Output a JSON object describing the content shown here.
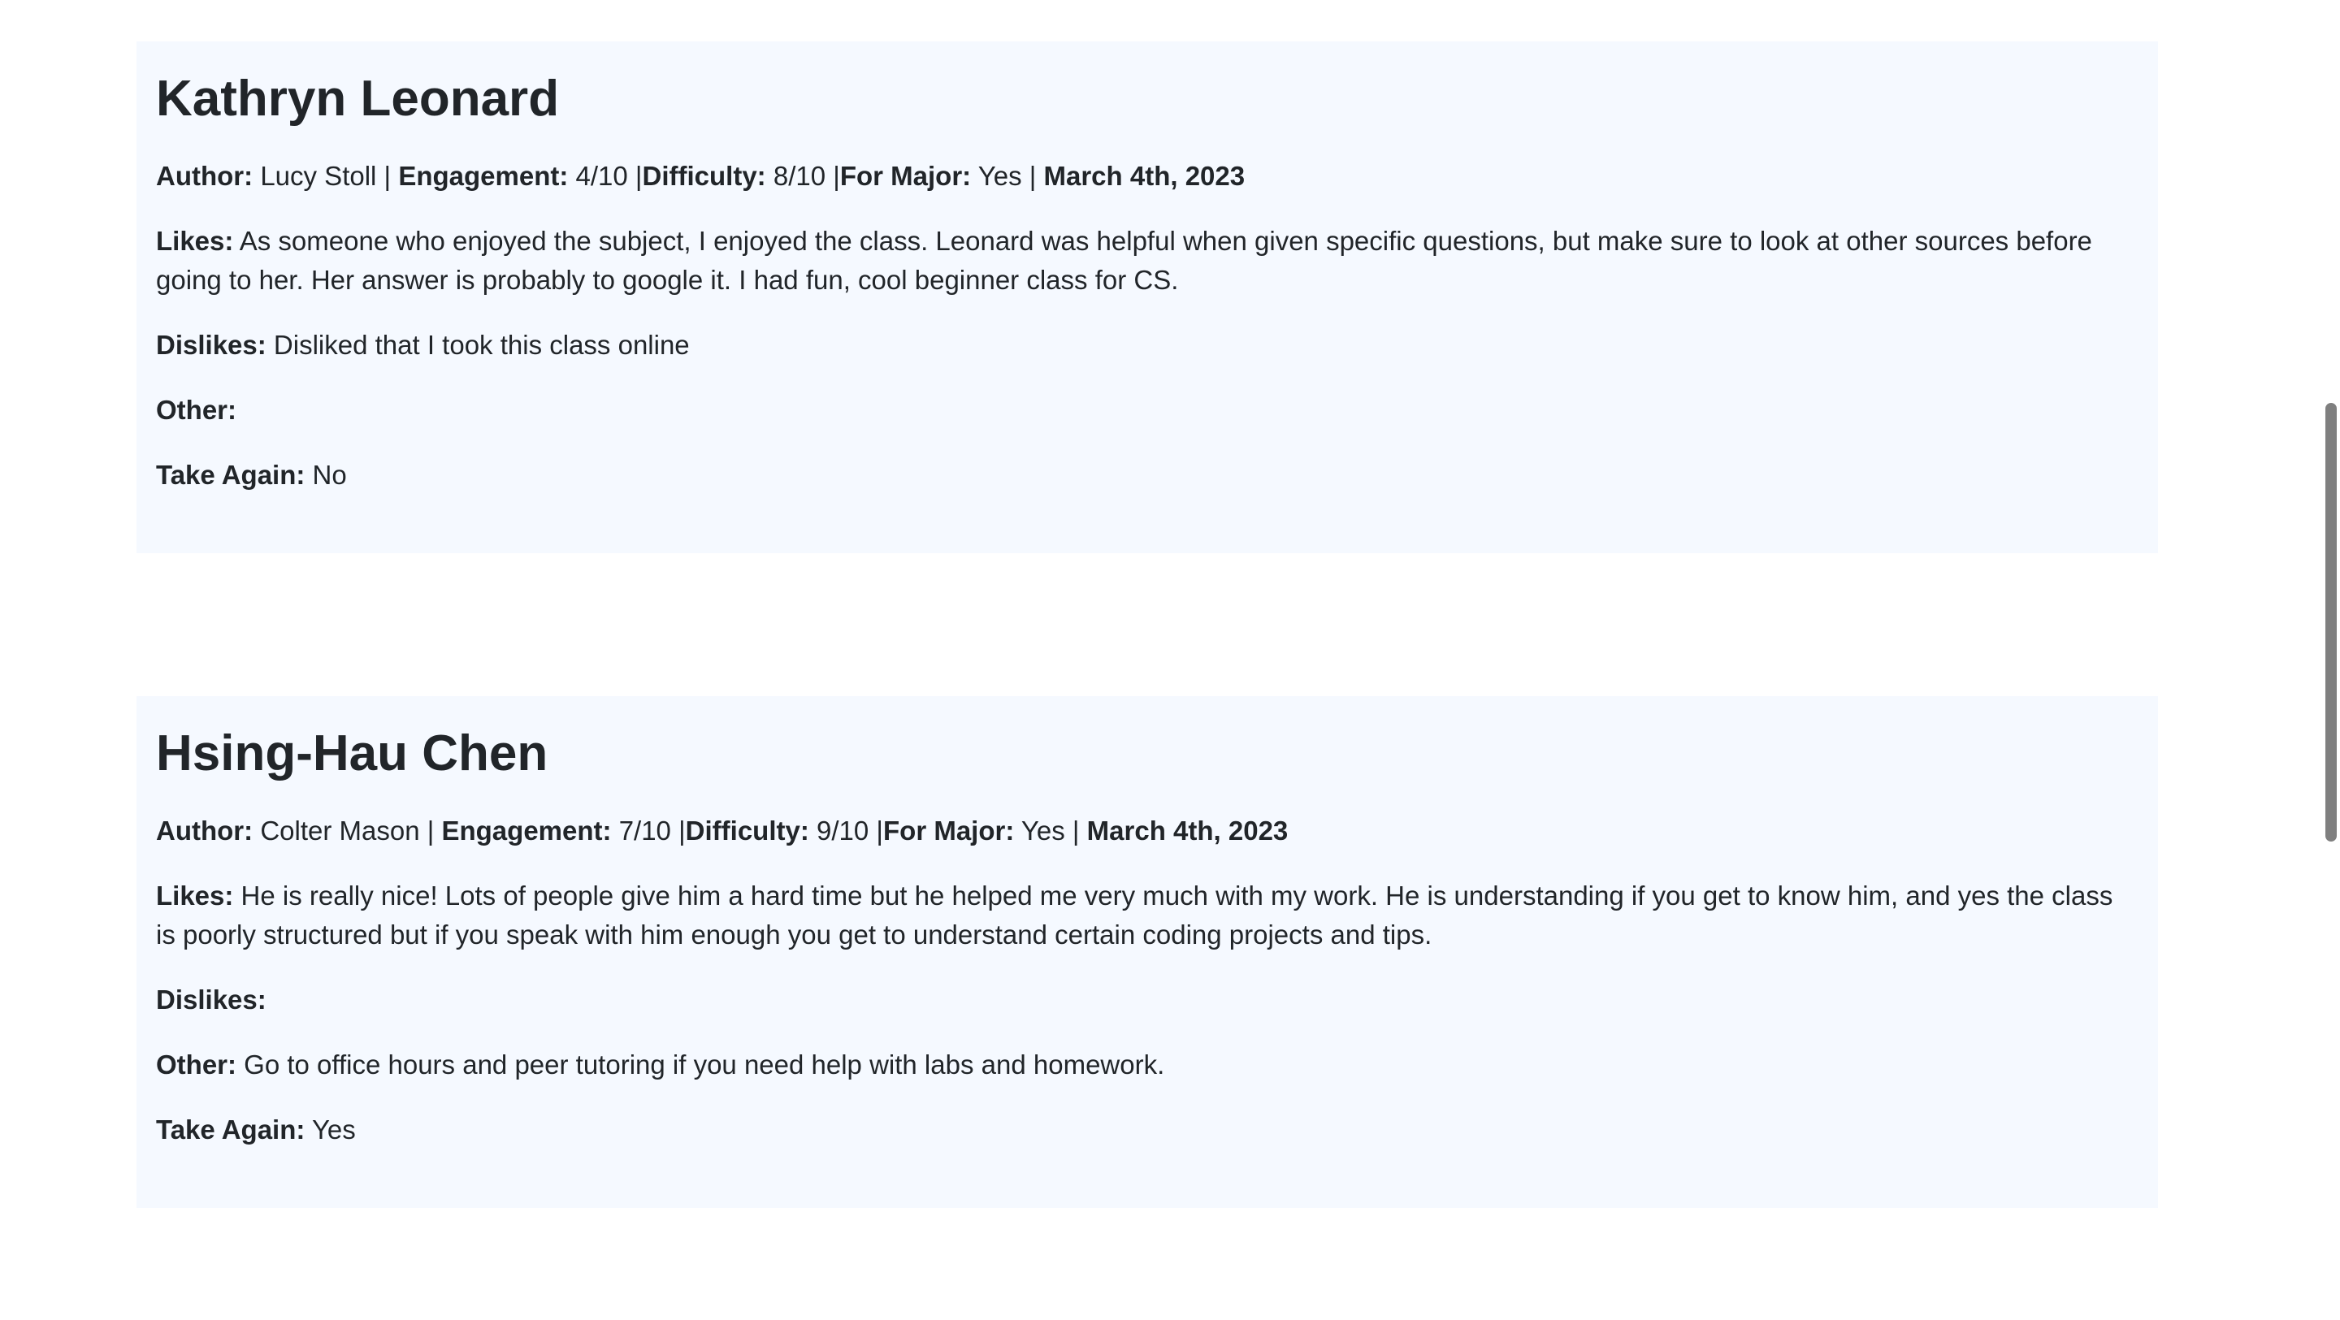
{
  "reviews": [
    {
      "professor": "Kathryn Leonard",
      "author_label": "Author:",
      "author": "Lucy Stoll",
      "engagement_label": "Engagement:",
      "engagement": "4/10",
      "difficulty_label": "Difficulty:",
      "difficulty": "8/10",
      "major_label": "For Major:",
      "major": "Yes",
      "date": "March 4th, 2023",
      "likes_label": "Likes:",
      "likes": "As someone who enjoyed the subject, I enjoyed the class. Leonard was helpful when given specific questions, but make sure to look at other sources before going to her. Her answer is probably to google it. I had fun, cool beginner class for CS.",
      "dislikes_label": "Dislikes:",
      "dislikes": "Disliked that I took this class online",
      "other_label": "Other:",
      "other": "",
      "take_again_label": "Take Again:",
      "take_again": "No"
    },
    {
      "professor": "Hsing-Hau Chen",
      "author_label": "Author:",
      "author": "Colter Mason",
      "engagement_label": "Engagement:",
      "engagement": "7/10",
      "difficulty_label": "Difficulty:",
      "difficulty": "9/10",
      "major_label": "For Major:",
      "major": "Yes",
      "date": "March 4th, 2023",
      "likes_label": "Likes:",
      "likes": "He is really nice! Lots of people give him a hard time but he helped me very much with my work. He is understanding if you get to know him, and yes the class is poorly structured but if you speak with him enough you get to understand certain coding projects and tips.",
      "dislikes_label": "Dislikes:",
      "dislikes": "",
      "other_label": "Other:",
      "other": "Go to office hours and peer tutoring if you need help with labs and homework.",
      "take_again_label": "Take Again:",
      "take_again": "Yes"
    }
  ],
  "colors": {
    "card_background": "#f5f9ff",
    "text": "#212529",
    "scrollbar_thumb": "#7f7f7f"
  }
}
